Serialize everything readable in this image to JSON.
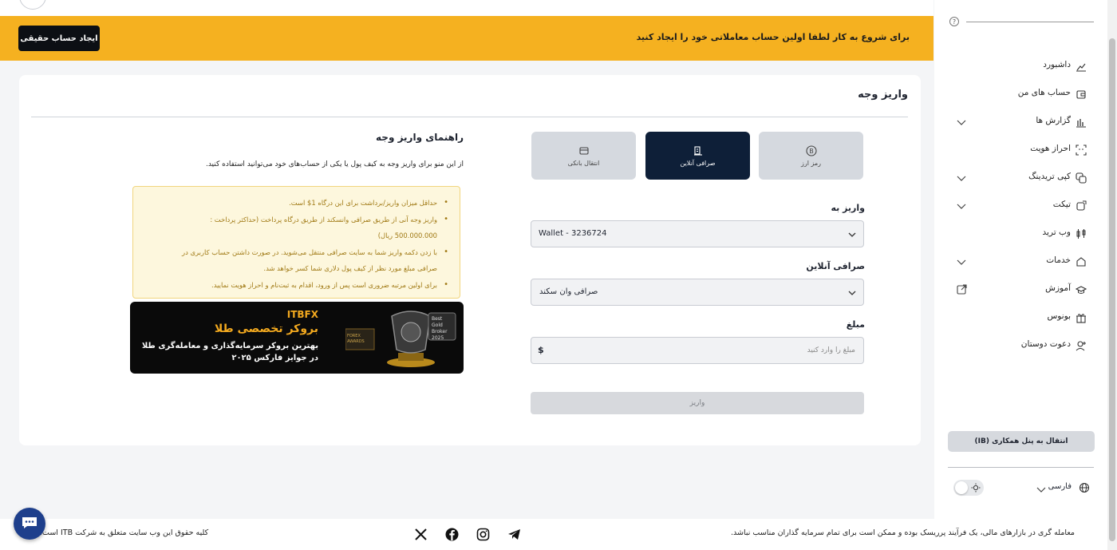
{
  "colors": {
    "banner": "#f5b120",
    "primary_dark": "#0e1f38",
    "notice_bg": "#fdf7dd",
    "notice_text": "#a07914",
    "promo_gold": "#f2a91f"
  },
  "banner": {
    "message": "برای شروع به کار لطفا اولین حساب معاملاتی خود را ایجاد کنید",
    "create_button": "ایجاد حساب حقیقی"
  },
  "card": {
    "title": "واریز وجه"
  },
  "tabs": [
    {
      "label": "رمز ارز",
      "icon": "bitcoin-icon",
      "active": false
    },
    {
      "label": "صرافی آنلاین",
      "icon": "exchange-icon",
      "active": true
    },
    {
      "label": "انتقال بانکی",
      "icon": "bank-card-icon",
      "active": false
    }
  ],
  "form": {
    "deposit_to_label": "واریز به",
    "deposit_to_value": "Wallet - 3236724",
    "exchange_label": "صرافی آنلاین",
    "exchange_value": "صرافی وان سکند",
    "amount_label": "مبلغ",
    "amount_placeholder": "مبلغ را وارد کنید",
    "currency": "$",
    "submit_label": "واریز"
  },
  "guide": {
    "title": "راهنمای واریز وجه",
    "subtitle": "از این منو برای واریز وجه به کیف پول یا یکی از حساب‌های خود می‌توانید استفاده کنید.",
    "notes": [
      "حداقل میزان واریز/برداشت برای این درگاه 1$ است.",
      "واریز وجه آنی از طریق صرافی وانسکند از طریق درگاه پرداخت (حداکثر پرداخت :",
      "500.000.000 ریال)",
      "با زدن دکمه واریز شما به سایت صرافی منتقل می‌شوید. در صورت داشتن حساب کاربری در",
      "صرافی مبلغ مورد نظر از کیف پول دلاری شما کسر خواهد شد.",
      "برای اولین مرتبه ضروری است پس از ورود، اقدام به ثبت‌نام و احراز هویت نمایید."
    ]
  },
  "promo": {
    "brand": "ITBFX",
    "headline": "بروکر تخصصی طلا",
    "line1": "بهترین بروکر سرمایه‌گذاری و معامله‌گری طلا",
    "line2": "در جوایز فارکس ۲۰۲۵",
    "award_text": "Best Gold Broker 2025",
    "award_badge": "FOREX AWARDS"
  },
  "sidebar": {
    "help": "?",
    "items": [
      {
        "label": "داشبورد",
        "icon": "dashboard-icon",
        "expandable": false
      },
      {
        "label": "حساب های من",
        "icon": "wallet-icon",
        "expandable": false
      },
      {
        "label": "گزارش ها",
        "icon": "reports-icon",
        "expandable": true
      },
      {
        "label": "احراز هویت",
        "icon": "face-id-icon",
        "expandable": false
      },
      {
        "label": "کپی تریدینگ",
        "icon": "copy-icon",
        "expandable": true
      },
      {
        "label": "تیکت",
        "icon": "ticket-icon",
        "expandable": true
      },
      {
        "label": "وب ترید",
        "icon": "candles-icon",
        "expandable": false
      },
      {
        "label": "خدمات",
        "icon": "services-icon",
        "expandable": true
      },
      {
        "label": "آموزش",
        "icon": "education-icon",
        "expandable": false,
        "external": true
      },
      {
        "label": "بونوس",
        "icon": "gift-icon",
        "expandable": false
      },
      {
        "label": "دعوت دوستان",
        "icon": "invite-icon",
        "expandable": false
      }
    ],
    "ib_button": "انتقال به پنل همکاری (IB)",
    "language": "فارسی"
  },
  "footer": {
    "risk": "معامله گری در بازارهای مالی، یک فرآیند پرریسک بوده و ممکن است برای تمام سرمایه گذاران مناسب نباشد.",
    "copyright": "کلیه حقوق این وب سایت متعلق به شرکت ITB است.",
    "socials": [
      "telegram-icon",
      "instagram-icon",
      "facebook-icon",
      "x-icon"
    ]
  }
}
